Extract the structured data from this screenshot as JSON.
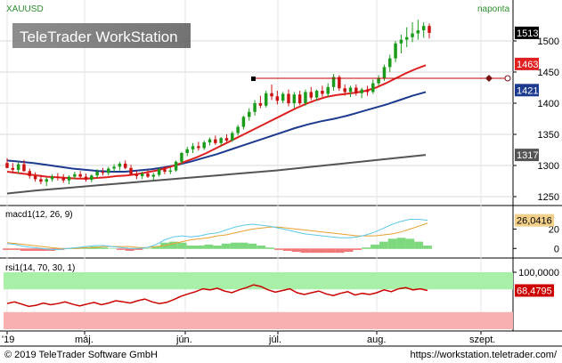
{
  "header": {
    "symbol": "XAUUSD",
    "period": "naponta",
    "watermark": "TeleTrader WorkStation"
  },
  "footer": {
    "copyright": "© 2019 TeleTrader Software GmbH",
    "url": "https://workstation.teletrader.com/"
  },
  "colors": {
    "up_candle": "#1a9b1a",
    "down_candle": "#cc1111",
    "ma_red": "#e02020",
    "ma_blue": "#1c3a8f",
    "ma_gray": "#555555",
    "hline": "#c00000",
    "macd_line": "#5bc8e8",
    "signal_line": "#e8a030",
    "hist_pos": "#7ed87e",
    "hist_neg": "#f07878",
    "rsi_line": "#cc0000",
    "rsi_upper_zone": "#a8f0a8",
    "rsi_lower_zone": "#f8b0b0"
  },
  "chart_data": [
    {
      "type": "candlestick",
      "title": "XAUUSD",
      "ylim": [
        1240,
        1540
      ],
      "y_ticks": [
        1250,
        1300,
        1350,
        1400,
        1450,
        1500
      ],
      "x_tick_labels": [
        "'19",
        "máj.",
        "jún.",
        "júl.",
        "aug.",
        "szept."
      ],
      "candles": [
        [
          1304,
          1312,
          1296,
          1296
        ],
        [
          1296,
          1304,
          1288,
          1293
        ],
        [
          1293,
          1306,
          1287,
          1302
        ],
        [
          1302,
          1309,
          1290,
          1291
        ],
        [
          1291,
          1295,
          1279,
          1283
        ],
        [
          1283,
          1289,
          1274,
          1278
        ],
        [
          1278,
          1285,
          1270,
          1274
        ],
        [
          1274,
          1281,
          1267,
          1278
        ],
        [
          1278,
          1286,
          1274,
          1282
        ],
        [
          1282,
          1288,
          1276,
          1280
        ],
        [
          1280,
          1286,
          1272,
          1276
        ],
        [
          1276,
          1284,
          1270,
          1282
        ],
        [
          1282,
          1290,
          1278,
          1286
        ],
        [
          1286,
          1291,
          1279,
          1282
        ],
        [
          1282,
          1287,
          1274,
          1277
        ],
        [
          1277,
          1286,
          1273,
          1284
        ],
        [
          1284,
          1294,
          1280,
          1290
        ],
        [
          1290,
          1296,
          1284,
          1288
        ],
        [
          1288,
          1298,
          1284,
          1295
        ],
        [
          1295,
          1302,
          1290,
          1298
        ],
        [
          1298,
          1306,
          1292,
          1303
        ],
        [
          1303,
          1308,
          1294,
          1296
        ],
        [
          1296,
          1301,
          1284,
          1286
        ],
        [
          1286,
          1292,
          1278,
          1283
        ],
        [
          1283,
          1290,
          1278,
          1287
        ],
        [
          1287,
          1292,
          1280,
          1282
        ],
        [
          1282,
          1288,
          1276,
          1285
        ],
        [
          1285,
          1296,
          1282,
          1294
        ],
        [
          1294,
          1299,
          1286,
          1290
        ],
        [
          1290,
          1297,
          1286,
          1292
        ],
        [
          1292,
          1308,
          1290,
          1306
        ],
        [
          1306,
          1322,
          1302,
          1320
        ],
        [
          1320,
          1330,
          1315,
          1326
        ],
        [
          1326,
          1336,
          1320,
          1331
        ],
        [
          1331,
          1338,
          1324,
          1328
        ],
        [
          1328,
          1340,
          1325,
          1337
        ],
        [
          1337,
          1345,
          1332,
          1342
        ],
        [
          1342,
          1348,
          1333,
          1336
        ],
        [
          1336,
          1346,
          1332,
          1344
        ],
        [
          1344,
          1350,
          1338,
          1340
        ],
        [
          1340,
          1355,
          1338,
          1352
        ],
        [
          1352,
          1365,
          1348,
          1362
        ],
        [
          1362,
          1380,
          1358,
          1378
        ],
        [
          1378,
          1392,
          1372,
          1386
        ],
        [
          1386,
          1405,
          1380,
          1400
        ],
        [
          1400,
          1412,
          1392,
          1396
        ],
        [
          1396,
          1420,
          1393,
          1416
        ],
        [
          1416,
          1430,
          1405,
          1411
        ],
        [
          1411,
          1420,
          1398,
          1404
        ],
        [
          1404,
          1418,
          1400,
          1415
        ],
        [
          1415,
          1422,
          1395,
          1400
        ],
        [
          1400,
          1418,
          1392,
          1414
        ],
        [
          1414,
          1420,
          1397,
          1400
        ],
        [
          1400,
          1422,
          1396,
          1418
        ],
        [
          1418,
          1426,
          1405,
          1409
        ],
        [
          1409,
          1422,
          1404,
          1420
        ],
        [
          1420,
          1428,
          1410,
          1415
        ],
        [
          1415,
          1432,
          1410,
          1426
        ],
        [
          1426,
          1447,
          1420,
          1442
        ],
        [
          1442,
          1445,
          1420,
          1424
        ],
        [
          1424,
          1430,
          1412,
          1418
        ],
        [
          1418,
          1428,
          1410,
          1425
        ],
        [
          1425,
          1430,
          1412,
          1416
        ],
        [
          1416,
          1425,
          1408,
          1422
        ],
        [
          1422,
          1428,
          1412,
          1418
        ],
        [
          1418,
          1438,
          1415,
          1432
        ],
        [
          1432,
          1445,
          1428,
          1440
        ],
        [
          1440,
          1462,
          1436,
          1458
        ],
        [
          1458,
          1478,
          1450,
          1472
        ],
        [
          1472,
          1500,
          1466,
          1496
        ],
        [
          1496,
          1510,
          1480,
          1502
        ],
        [
          1502,
          1522,
          1490,
          1506
        ],
        [
          1506,
          1530,
          1498,
          1512
        ],
        [
          1512,
          1534,
          1502,
          1517
        ],
        [
          1517,
          1530,
          1505,
          1524
        ],
        [
          1524,
          1528,
          1504,
          1513
        ]
      ],
      "ma_red": [
        1290,
        1288,
        1286,
        1284,
        1282,
        1281,
        1280,
        1279,
        1279,
        1280,
        1281,
        1283,
        1284,
        1286,
        1289,
        1292,
        1296,
        1301,
        1307,
        1313,
        1320,
        1328,
        1336,
        1344,
        1352,
        1360,
        1368,
        1376,
        1384,
        1392,
        1399,
        1405,
        1410,
        1413,
        1415,
        1417,
        1420,
        1425,
        1432,
        1440,
        1448,
        1455,
        1461
      ],
      "ma_blue": [
        1308,
        1306,
        1304,
        1301,
        1298,
        1295,
        1293,
        1291,
        1290,
        1290,
        1292,
        1294,
        1297,
        1301,
        1306,
        1312,
        1318,
        1325,
        1332,
        1339,
        1346,
        1353,
        1360,
        1366,
        1371,
        1375,
        1380,
        1386,
        1392,
        1398,
        1405,
        1412,
        1418
      ],
      "ma_gray": [
        1255,
        1260,
        1264,
        1268,
        1272,
        1276,
        1280,
        1284,
        1288,
        1292,
        1297,
        1302,
        1307,
        1312,
        1317
      ],
      "hline": {
        "value": 1440
      },
      "current_labels": [
        "1513",
        "1463",
        "1421",
        "1317"
      ]
    },
    {
      "type": "line",
      "title": "macd1(12, 26, 9)",
      "y_ticks": [
        "0",
        "20"
      ],
      "ylim": [
        -8,
        36
      ],
      "macd": [
        5,
        4,
        2,
        1,
        0,
        -1,
        -1,
        0,
        1,
        2,
        3,
        3,
        2,
        1,
        0,
        0,
        1,
        4,
        9,
        12,
        13,
        12,
        13,
        15,
        16,
        19,
        22,
        24,
        25,
        24,
        23,
        21,
        19,
        17,
        15,
        14,
        13,
        12,
        11,
        11,
        12,
        14,
        17,
        21,
        25,
        28,
        30,
        30,
        29
      ],
      "signal": [
        6,
        5,
        4,
        3,
        2,
        1,
        0,
        0,
        0,
        1,
        1,
        2,
        2,
        2,
        2,
        1,
        1,
        2,
        3,
        5,
        7,
        9,
        10,
        11,
        13,
        14,
        16,
        18,
        20,
        21,
        22,
        22,
        21,
        20,
        19,
        18,
        17,
        16,
        15,
        14,
        13,
        13,
        13,
        14,
        15,
        17,
        20,
        23,
        26
      ],
      "current_label": "26,0416"
    },
    {
      "type": "line",
      "title": "rsi1(14, 70, 30, 1)",
      "ylim": [
        0,
        100
      ],
      "upper": 70,
      "lower": 30,
      "rsi": [
        45,
        48,
        44,
        40,
        42,
        46,
        43,
        45,
        48,
        44,
        41,
        44,
        47,
        43,
        46,
        50,
        48,
        46,
        50,
        53,
        48,
        45,
        47,
        52,
        58,
        62,
        66,
        71,
        69,
        72,
        67,
        64,
        69,
        73,
        78,
        75,
        69,
        65,
        68,
        71,
        64,
        61,
        64,
        67,
        62,
        59,
        63,
        66,
        60,
        63,
        61,
        64,
        69,
        66,
        71,
        73,
        69,
        71,
        68
      ],
      "label_100": "100,0000",
      "current_label": "68,4795"
    }
  ]
}
